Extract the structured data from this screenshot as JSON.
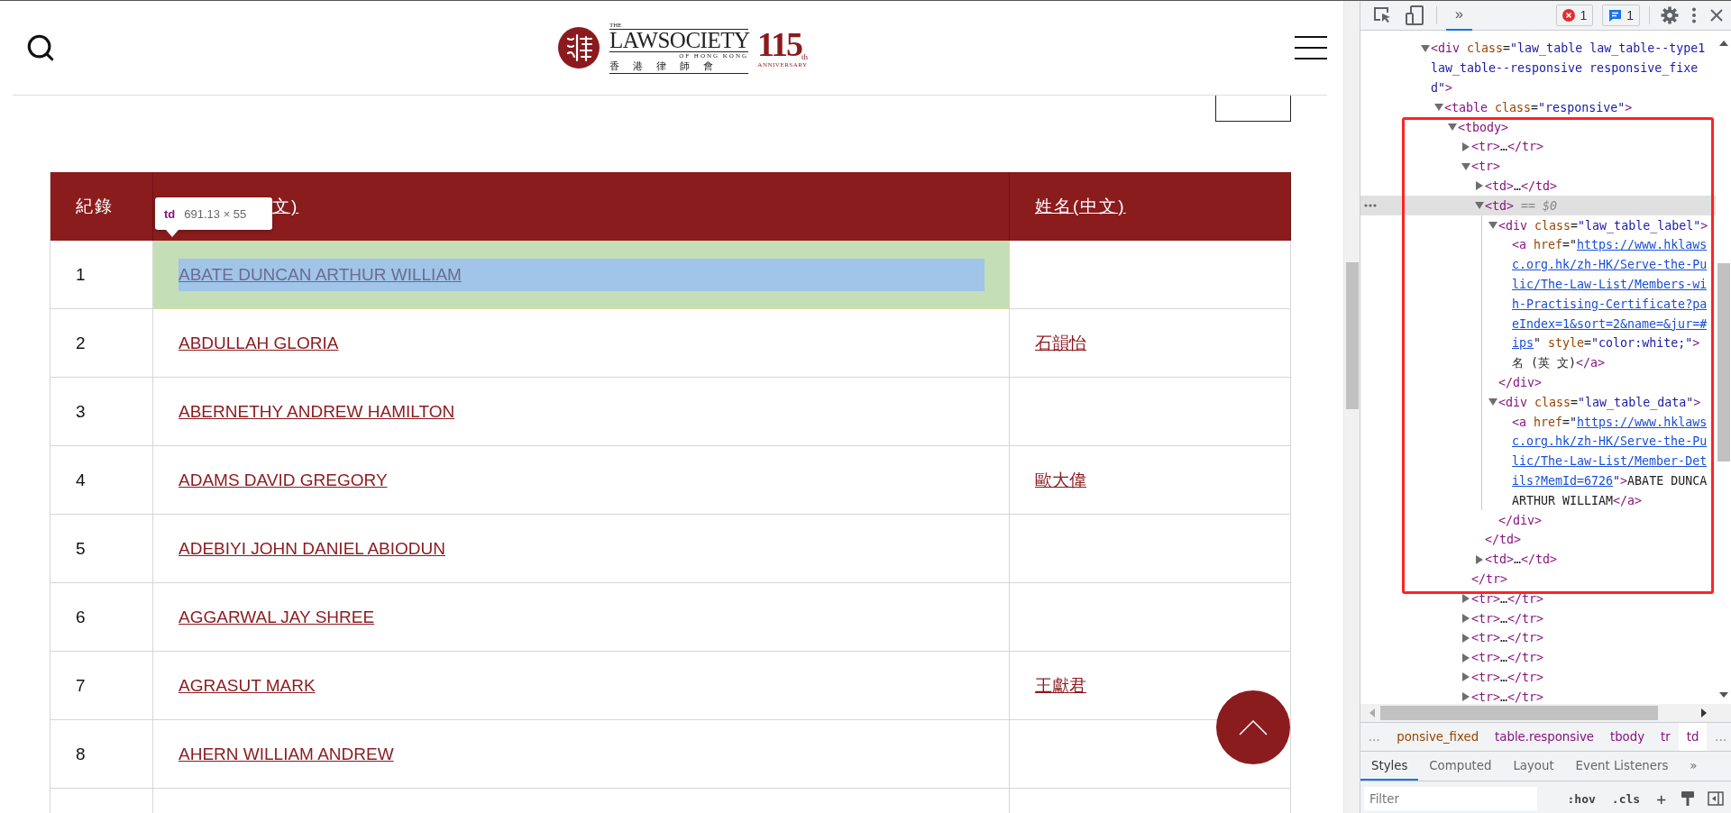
{
  "header": {
    "logo": {
      "the": "THE",
      "name": "LAWSOCIETY",
      "subtitle": "OF HONG KONG",
      "chinese": "香 港 律 師 會",
      "anniversary_number": "115",
      "anniversary_suffix": "th",
      "anniversary_label": "ANNIVERSARY"
    }
  },
  "table": {
    "columns": [
      {
        "label": "紀錄",
        "link": false
      },
      {
        "label": "文)",
        "link": true
      },
      {
        "label": "姓名(中文)",
        "link": true
      }
    ],
    "rows": [
      {
        "record": "1",
        "name_en": "ABATE DUNCAN ARTHUR WILLIAM",
        "inspected": true
      },
      {
        "record": "2",
        "name_en": "ABDULLAH GLORIA",
        "name_zh": "石韻怡",
        "inspected": false
      },
      {
        "record": "3",
        "name_en": "ABERNETHY ANDREW HAMILTON",
        "inspected": false
      },
      {
        "record": "4",
        "name_en": "ADAMS DAVID GREGORY",
        "name_zh": "歐大偉",
        "inspected": false
      },
      {
        "record": "5",
        "name_en": "ADEBIYI JOHN DANIEL ABIODUN",
        "inspected": false
      },
      {
        "record": "6",
        "name_en": "AGGARWAL JAY SHREE",
        "inspected": false
      },
      {
        "record": "7",
        "name_en": "AGRASUT MARK",
        "name_zh": "王獻君",
        "inspected": false
      },
      {
        "record": "8",
        "name_en": "AHERN WILLIAM ANDREW",
        "inspected": false
      }
    ],
    "inspector_tooltip": {
      "tag": "td",
      "size": "691.13 × 55"
    }
  },
  "devtools": {
    "toolbar": {
      "more": "»",
      "errors": "1",
      "messages": "1"
    },
    "elements": [
      {
        "kind": "open",
        "selected": false,
        "lines": [
          [
            {
              "kind": "tag",
              "text": "<div"
            },
            {
              "kind": "attr",
              "text": " class"
            },
            {
              "kind": "text",
              "text": "="
            },
            {
              "kind": "value",
              "text": "\"law_table law_table--type1"
            }
          ],
          [
            {
              "kind": "value",
              "text": "law_table--responsive responsive_fixe"
            }
          ],
          [
            {
              "kind": "value",
              "text": "d\""
            },
            {
              "kind": "tag",
              "text": ">"
            }
          ]
        ],
        "children": [
          {
            "kind": "open",
            "selected": false,
            "lines": [
              [
                {
                  "kind": "tag",
                  "text": "<table"
                },
                {
                  "kind": "attr",
                  "text": " class"
                },
                {
                  "kind": "text",
                  "text": "="
                },
                {
                  "kind": "value",
                  "text": "\"responsive\""
                },
                {
                  "kind": "tag",
                  "text": ">"
                }
              ]
            ],
            "children": [
              {
                "kind": "open",
                "selected": false,
                "lines": [
                  [
                    {
                      "kind": "tag",
                      "text": "<tbody>"
                    }
                  ]
                ],
                "children": [
                  {
                    "kind": "collapsed",
                    "selected": false,
                    "lines": [
                      [
                        {
                          "kind": "tag",
                          "text": "<tr>"
                        },
                        {
                          "kind": "text",
                          "text": "…"
                        },
                        {
                          "kind": "tag",
                          "text": "</tr>"
                        }
                      ]
                    ]
                  },
                  {
                    "kind": "open",
                    "selected": false,
                    "lines": [
                      [
                        {
                          "kind": "tag",
                          "text": "<tr>"
                        }
                      ]
                    ],
                    "close": [
                      [
                        {
                          "kind": "tag",
                          "text": "</tr>"
                        }
                      ]
                    ],
                    "children": [
                      {
                        "kind": "collapsed",
                        "selected": false,
                        "lines": [
                          [
                            {
                              "kind": "tag",
                              "text": "<td>"
                            },
                            {
                              "kind": "text",
                              "text": "…"
                            },
                            {
                              "kind": "tag",
                              "text": "</td>"
                            }
                          ]
                        ]
                      },
                      {
                        "kind": "open",
                        "selected": true,
                        "lines": [
                          [
                            {
                              "kind": "tag",
                              "text": "<td>"
                            },
                            {
                              "kind": "hint",
                              "text": " == $0"
                            }
                          ]
                        ],
                        "close": [
                          [
                            {
                              "kind": "tag",
                              "text": "</td>"
                            }
                          ]
                        ],
                        "children": [
                          {
                            "kind": "open",
                            "selected": false,
                            "lines": [
                              [
                                {
                                  "kind": "tag",
                                  "text": "<div"
                                },
                                {
                                  "kind": "attr",
                                  "text": " class"
                                },
                                {
                                  "kind": "text",
                                  "text": "="
                                },
                                {
                                  "kind": "value",
                                  "text": "\"law_table_label\""
                                },
                                {
                                  "kind": "tag",
                                  "text": ">"
                                }
                              ]
                            ],
                            "close": [
                              [
                                {
                                  "kind": "tag",
                                  "text": "</div>"
                                }
                              ]
                            ],
                            "children": [
                              {
                                "kind": "leaf",
                                "selected": false,
                                "lines": [
                                  [
                                    {
                                      "kind": "tag",
                                      "text": "<a"
                                    },
                                    {
                                      "kind": "attr",
                                      "text": " href"
                                    },
                                    {
                                      "kind": "text",
                                      "text": "=\""
                                    },
                                    {
                                      "kind": "link",
                                      "text": "https://www.hklaws"
                                    }
                                  ],
                                  [
                                    {
                                      "kind": "link",
                                      "text": "c.org.hk/zh-HK/Serve-the-Pu"
                                    }
                                  ],
                                  [
                                    {
                                      "kind": "link",
                                      "text": "lic/The-Law-List/Members-wi"
                                    }
                                  ],
                                  [
                                    {
                                      "kind": "link",
                                      "text": "h-Practising-Certificate?pa"
                                    }
                                  ],
                                  [
                                    {
                                      "kind": "link",
                                      "text": "eIndex=1&sort=2&name=&jur=#"
                                    }
                                  ],
                                  [
                                    {
                                      "kind": "link",
                                      "text": "ips"
                                    },
                                    {
                                      "kind": "text",
                                      "text": "\" "
                                    },
                                    {
                                      "kind": "attr",
                                      "text": "style"
                                    },
                                    {
                                      "kind": "text",
                                      "text": "="
                                    },
                                    {
                                      "kind": "value",
                                      "text": "\"color:white;\""
                                    },
                                    {
                                      "kind": "tag",
                                      "text": ">"
                                    }
                                  ],
                                  [
                                    {
                                      "kind": "text",
                                      "text": "名 (英 文)"
                                    },
                                    {
                                      "kind": "tag",
                                      "text": "</a>"
                                    }
                                  ]
                                ]
                              }
                            ]
                          },
                          {
                            "kind": "open",
                            "selected": false,
                            "lines": [
                              [
                                {
                                  "kind": "tag",
                                  "text": "<div"
                                },
                                {
                                  "kind": "attr",
                                  "text": " class"
                                },
                                {
                                  "kind": "text",
                                  "text": "="
                                },
                                {
                                  "kind": "value",
                                  "text": "\"law_table_data\""
                                },
                                {
                                  "kind": "tag",
                                  "text": ">"
                                }
                              ]
                            ],
                            "close": [
                              [
                                {
                                  "kind": "tag",
                                  "text": "</div>"
                                }
                              ]
                            ],
                            "children": [
                              {
                                "kind": "leaf",
                                "selected": false,
                                "lines": [
                                  [
                                    {
                                      "kind": "tag",
                                      "text": "<a"
                                    },
                                    {
                                      "kind": "attr",
                                      "text": " href"
                                    },
                                    {
                                      "kind": "text",
                                      "text": "=\""
                                    },
                                    {
                                      "kind": "link",
                                      "text": "https://www.hklaws"
                                    }
                                  ],
                                  [
                                    {
                                      "kind": "link",
                                      "text": "c.org.hk/zh-HK/Serve-the-Pu"
                                    }
                                  ],
                                  [
                                    {
                                      "kind": "link",
                                      "text": "lic/The-Law-List/Member-Det"
                                    }
                                  ],
                                  [
                                    {
                                      "kind": "link",
                                      "text": "ils?MemId=6726"
                                    },
                                    {
                                      "kind": "value",
                                      "text": "\""
                                    },
                                    {
                                      "kind": "tag",
                                      "text": ">"
                                    },
                                    {
                                      "kind": "text",
                                      "text": "ABATE DUNCA"
                                    }
                                  ],
                                  [
                                    {
                                      "kind": "text",
                                      "text": "ARTHUR WILLIAM"
                                    },
                                    {
                                      "kind": "tag",
                                      "text": "</a>"
                                    }
                                  ]
                                ]
                              }
                            ]
                          }
                        ]
                      },
                      {
                        "kind": "collapsed",
                        "selected": false,
                        "lines": [
                          [
                            {
                              "kind": "tag",
                              "text": "<td>"
                            },
                            {
                              "kind": "text",
                              "text": "…"
                            },
                            {
                              "kind": "tag",
                              "text": "</td>"
                            }
                          ]
                        ]
                      }
                    ]
                  },
                  {
                    "kind": "collapsed",
                    "selected": false,
                    "lines": [
                      [
                        {
                          "kind": "tag",
                          "text": "<tr>"
                        },
                        {
                          "kind": "text",
                          "text": "…"
                        },
                        {
                          "kind": "tag",
                          "text": "</tr>"
                        }
                      ]
                    ]
                  },
                  {
                    "kind": "collapsed",
                    "selected": false,
                    "lines": [
                      [
                        {
                          "kind": "tag",
                          "text": "<tr>"
                        },
                        {
                          "kind": "text",
                          "text": "…"
                        },
                        {
                          "kind": "tag",
                          "text": "</tr>"
                        }
                      ]
                    ]
                  },
                  {
                    "kind": "collapsed",
                    "selected": false,
                    "lines": [
                      [
                        {
                          "kind": "tag",
                          "text": "<tr>"
                        },
                        {
                          "kind": "text",
                          "text": "…"
                        },
                        {
                          "kind": "tag",
                          "text": "</tr>"
                        }
                      ]
                    ]
                  },
                  {
                    "kind": "collapsed",
                    "selected": false,
                    "lines": [
                      [
                        {
                          "kind": "tag",
                          "text": "<tr>"
                        },
                        {
                          "kind": "text",
                          "text": "…"
                        },
                        {
                          "kind": "tag",
                          "text": "</tr>"
                        }
                      ]
                    ]
                  },
                  {
                    "kind": "collapsed",
                    "selected": false,
                    "lines": [
                      [
                        {
                          "kind": "tag",
                          "text": "<tr>"
                        },
                        {
                          "kind": "text",
                          "text": "…"
                        },
                        {
                          "kind": "tag",
                          "text": "</tr>"
                        }
                      ]
                    ]
                  },
                  {
                    "kind": "collapsed",
                    "selected": false,
                    "lines": [
                      [
                        {
                          "kind": "tag",
                          "text": "<tr>"
                        },
                        {
                          "kind": "text",
                          "text": "…"
                        },
                        {
                          "kind": "tag",
                          "text": "</tr>"
                        }
                      ]
                    ]
                  }
                ]
              }
            ]
          }
        ]
      }
    ],
    "breadcrumbs": [
      {
        "selected": false,
        "tokens": [
          {
            "kind": "hint",
            "text": "…"
          }
        ]
      },
      {
        "selected": false,
        "tokens": [
          {
            "kind": "attr",
            "text": "ponsive_fixed"
          }
        ]
      },
      {
        "selected": false,
        "tokens": [
          {
            "kind": "tag",
            "text": "table.responsive"
          }
        ]
      },
      {
        "selected": false,
        "tokens": [
          {
            "kind": "tag",
            "text": "tbody"
          }
        ]
      },
      {
        "selected": false,
        "tokens": [
          {
            "kind": "tag",
            "text": "tr"
          }
        ]
      },
      {
        "selected": true,
        "tokens": [
          {
            "kind": "tag",
            "text": "td"
          }
        ]
      },
      {
        "selected": false,
        "tokens": [
          {
            "kind": "hint",
            "text": "…"
          }
        ]
      }
    ],
    "tabs": [
      {
        "label": "Styles",
        "selected": true
      },
      {
        "label": "Computed",
        "selected": false
      },
      {
        "label": "Layout",
        "selected": false
      },
      {
        "label": "Event Listeners",
        "selected": false
      }
    ],
    "more_tabs": "»",
    "filter": {
      "placeholder": "Filter"
    },
    "toggles": [
      ":hov",
      ".cls"
    ],
    "add": "+"
  }
}
